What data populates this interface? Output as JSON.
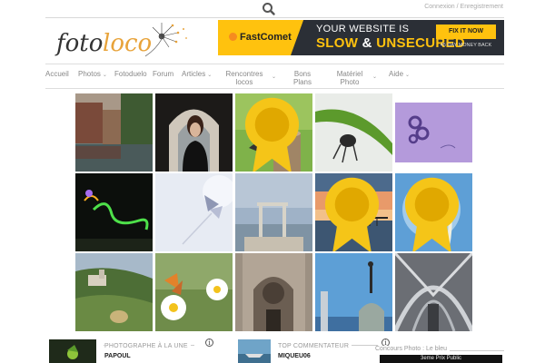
{
  "header": {
    "search_icon": "search-icon",
    "connect_label": "Connexion / Enregistrement"
  },
  "logo": {
    "text_a": "foto",
    "text_b": "loco"
  },
  "ad": {
    "brand": "FastComet",
    "line1": "YOUR WEBSITE IS",
    "line2_a": "SLOW",
    "line2_amp": " & ",
    "line2_b": "UNSECURED",
    "cta": "FIX IT NOW",
    "small": "45 DAY MONEY BACK"
  },
  "nav": {
    "items": [
      {
        "label": "Accueil",
        "dropdown": false
      },
      {
        "label": "Photos",
        "dropdown": true
      },
      {
        "label": "Fotoduelo",
        "dropdown": false
      },
      {
        "label": "Forum",
        "dropdown": false
      },
      {
        "label": "Articles",
        "dropdown": true
      },
      {
        "label": "Rencontres locos",
        "dropdown": true
      },
      {
        "label": "Bons Plans",
        "dropdown": false
      },
      {
        "label": "Matériel Photo",
        "dropdown": true
      },
      {
        "label": "Aide",
        "dropdown": true
      }
    ]
  },
  "gallery": {
    "photos": [
      {
        "subject": "canal-houses",
        "medal": false
      },
      {
        "subject": "woman-portrait",
        "medal": false
      },
      {
        "subject": "birds-on-post",
        "medal": true
      },
      {
        "subject": "insect-on-leaf",
        "medal": false
      },
      {
        "subject": "purple-jewel",
        "medal": false
      },
      {
        "subject": "light-painting",
        "medal": false
      },
      {
        "subject": "butterfly-white",
        "medal": false
      },
      {
        "subject": "pier-gate",
        "medal": false
      },
      {
        "subject": "sunset-pier",
        "medal": true
      },
      {
        "subject": "butterfly-blue",
        "medal": true
      },
      {
        "subject": "castle-hills",
        "medal": false
      },
      {
        "subject": "butterfly-daisy",
        "medal": false
      },
      {
        "subject": "cathedral-facade",
        "medal": false
      },
      {
        "subject": "statue-dome",
        "medal": false
      },
      {
        "subject": "vaulted-ceiling",
        "medal": false
      }
    ]
  },
  "footer": {
    "featured_title": "Photographe à la une",
    "featured_name": "PAPOUL",
    "commenter_title": "Top commentateur",
    "commenter_name": "MIQUEU06",
    "contest_title": "Concours Photo : Le bleu",
    "contest_prize": "3eme Prix Public"
  },
  "colors": {
    "accent": "#ffc20e",
    "ad_dark": "#2b2f36",
    "nav_text": "#888888"
  }
}
